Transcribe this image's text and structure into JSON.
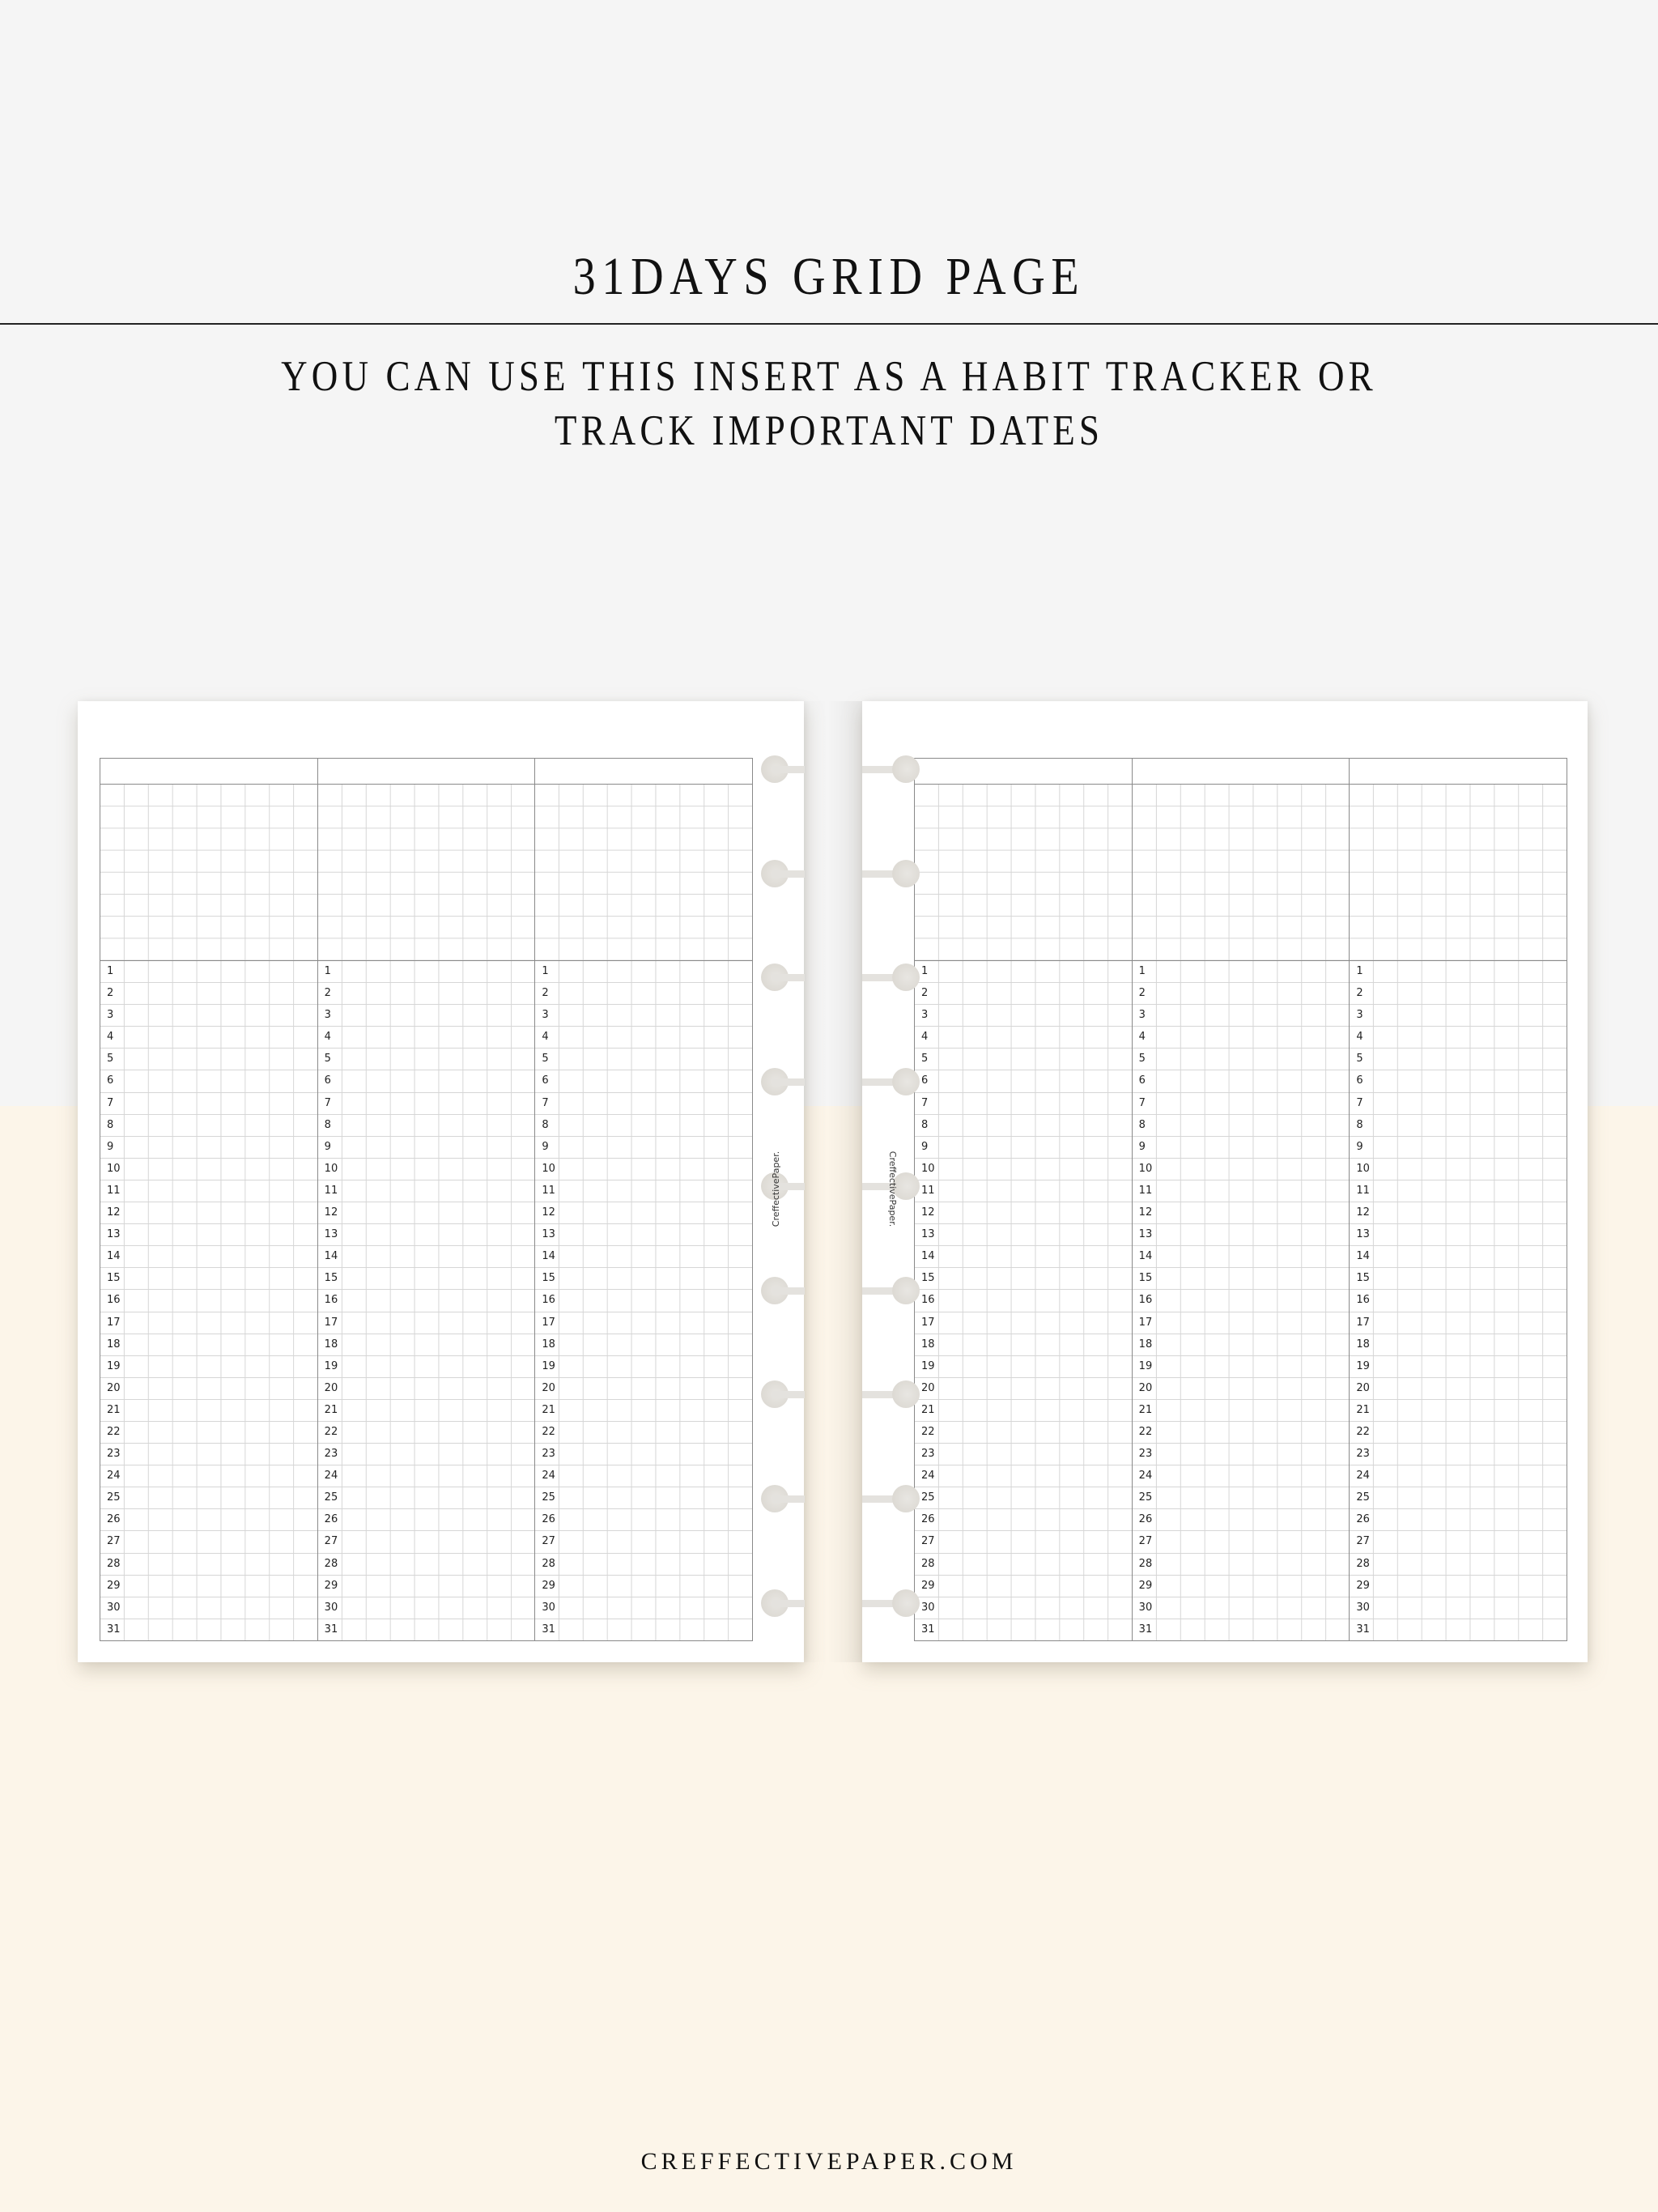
{
  "header": {
    "title": "31DAYS GRID PAGE",
    "subtitle_lines": [
      "YOU CAN USE THIS INSERT AS A HABIT TRACKER OR",
      "TRACK IMPORTANT DATES"
    ]
  },
  "pages": [
    {
      "name": "left",
      "columns": 3,
      "top_grid_rows": 8,
      "day_rows": 31
    },
    {
      "name": "right",
      "columns": 3,
      "top_grid_rows": 8,
      "day_rows": 31
    }
  ],
  "day_numbers": [
    "1",
    "2",
    "3",
    "4",
    "5",
    "6",
    "7",
    "8",
    "9",
    "10",
    "11",
    "12",
    "13",
    "14",
    "15",
    "16",
    "17",
    "18",
    "19",
    "20",
    "21",
    "22",
    "23",
    "24",
    "25",
    "26",
    "27",
    "28",
    "29",
    "30",
    "31"
  ],
  "ring_count": 9,
  "watermark": "CreffectivePaper.",
  "footer": {
    "website": "CREFFECTIVEPAPER.COM"
  },
  "colors": {
    "top_background": "#f5f5f5",
    "bottom_background": "#fcf5e9",
    "grid_line": "#d6d6d6",
    "grid_border": "#8a8a8a"
  }
}
